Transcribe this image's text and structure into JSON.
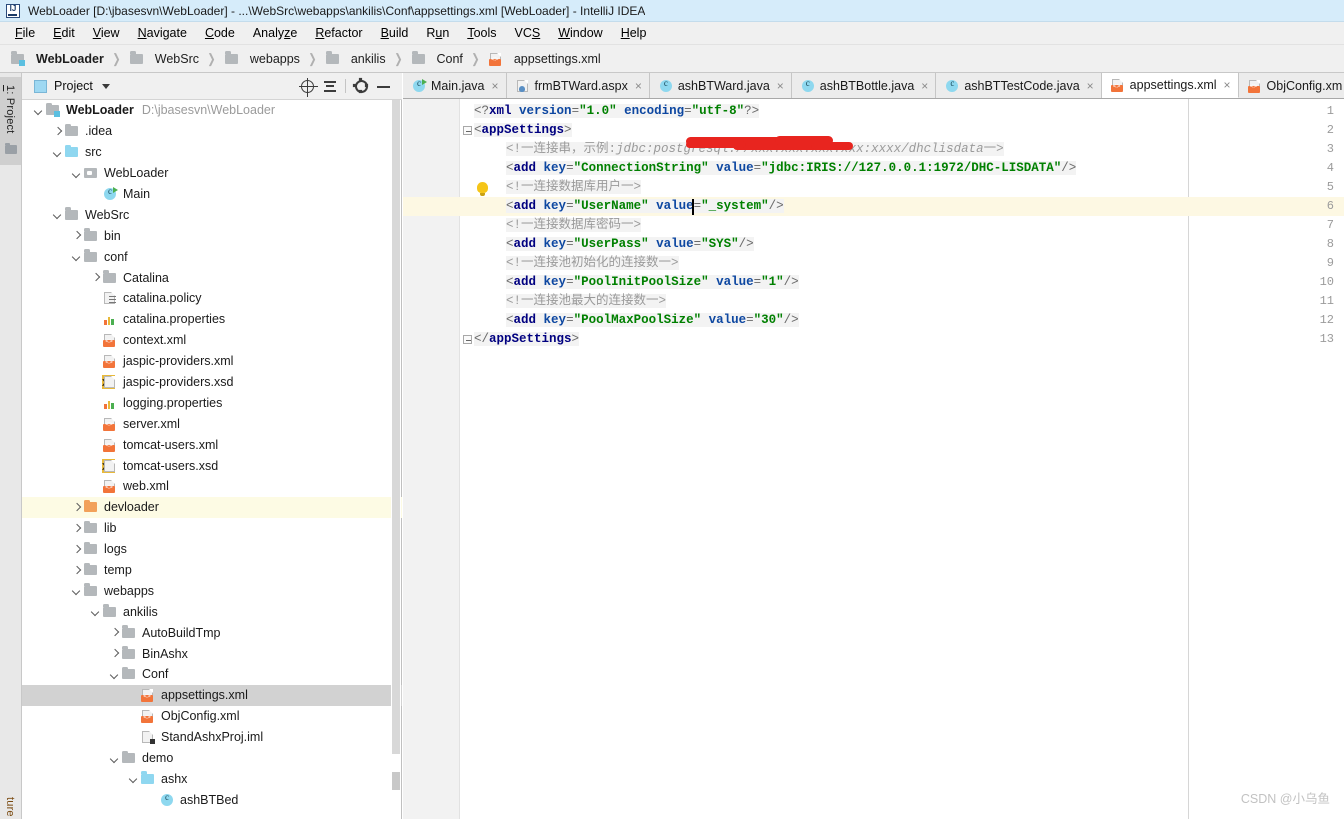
{
  "window": {
    "title": "WebLoader [D:\\jbasesvn\\WebLoader] - ...\\WebSrc\\webapps\\ankilis\\Conf\\appsettings.xml [WebLoader] - IntelliJ IDEA",
    "app_icon": "intellij-idea-logo"
  },
  "menubar": [
    {
      "label": "File",
      "mnemonic": "F"
    },
    {
      "label": "Edit",
      "mnemonic": "E"
    },
    {
      "label": "View",
      "mnemonic": "V"
    },
    {
      "label": "Navigate",
      "mnemonic": "N"
    },
    {
      "label": "Code",
      "mnemonic": "C"
    },
    {
      "label": "Analyze",
      "mnemonic": "z"
    },
    {
      "label": "Refactor",
      "mnemonic": "R"
    },
    {
      "label": "Build",
      "mnemonic": "B"
    },
    {
      "label": "Run",
      "mnemonic": "u"
    },
    {
      "label": "Tools",
      "mnemonic": "T"
    },
    {
      "label": "VCS",
      "mnemonic": "S"
    },
    {
      "label": "Window",
      "mnemonic": "W"
    },
    {
      "label": "Help",
      "mnemonic": "H"
    }
  ],
  "breadcrumb": [
    {
      "label": "WebLoader",
      "icon": "module-icon"
    },
    {
      "label": "WebSrc",
      "icon": "folder-icon"
    },
    {
      "label": "webapps",
      "icon": "folder-icon"
    },
    {
      "label": "ankilis",
      "icon": "folder-icon"
    },
    {
      "label": "Conf",
      "icon": "folder-icon"
    },
    {
      "label": "appsettings.xml",
      "icon": "xml-file-icon"
    }
  ],
  "toolstrip": {
    "top_label": "1: Project",
    "top_mnemonic": "1",
    "bottom_label": "ture",
    "folder_icon": "folder-icon"
  },
  "project_panel": {
    "title": "Project",
    "actions": [
      {
        "name": "select-opened-file-button",
        "icon": "target-icon"
      },
      {
        "name": "collapse-all-button",
        "icon": "collapse-all-icon"
      },
      {
        "name": "settings-button",
        "icon": "gear-icon"
      },
      {
        "name": "hide-button",
        "icon": "minus-icon"
      }
    ],
    "tree": [
      {
        "label": "WebLoader",
        "sub": "D:\\jbasesvn\\WebLoader",
        "depth": 0,
        "twist": "d",
        "icon": "module-icon",
        "bold": true
      },
      {
        "label": ".idea",
        "depth": 1,
        "twist": "r",
        "icon": "folder-icon"
      },
      {
        "label": "src",
        "depth": 1,
        "twist": "d",
        "icon": "source-folder-icon"
      },
      {
        "label": "WebLoader",
        "depth": 2,
        "twist": "d",
        "icon": "package-icon"
      },
      {
        "label": "Main",
        "depth": 3,
        "twist": "",
        "icon": "java-class-runnable-icon"
      },
      {
        "label": "WebSrc",
        "depth": 1,
        "twist": "d",
        "icon": "folder-icon"
      },
      {
        "label": "bin",
        "depth": 2,
        "twist": "r",
        "icon": "folder-icon"
      },
      {
        "label": "conf",
        "depth": 2,
        "twist": "d",
        "icon": "folder-icon"
      },
      {
        "label": "Catalina",
        "depth": 3,
        "twist": "r",
        "icon": "folder-icon"
      },
      {
        "label": "catalina.policy",
        "depth": 3,
        "twist": "",
        "icon": "policy-file-icon"
      },
      {
        "label": "catalina.properties",
        "depth": 3,
        "twist": "",
        "icon": "properties-file-icon"
      },
      {
        "label": "context.xml",
        "depth": 3,
        "twist": "",
        "icon": "xml-file-icon"
      },
      {
        "label": "jaspic-providers.xml",
        "depth": 3,
        "twist": "",
        "icon": "xml-file-icon"
      },
      {
        "label": "jaspic-providers.xsd",
        "depth": 3,
        "twist": "",
        "icon": "xsd-file-icon"
      },
      {
        "label": "logging.properties",
        "depth": 3,
        "twist": "",
        "icon": "properties-file-icon"
      },
      {
        "label": "server.xml",
        "depth": 3,
        "twist": "",
        "icon": "xml-file-icon"
      },
      {
        "label": "tomcat-users.xml",
        "depth": 3,
        "twist": "",
        "icon": "xml-file-icon"
      },
      {
        "label": "tomcat-users.xsd",
        "depth": 3,
        "twist": "",
        "icon": "xsd-file-icon"
      },
      {
        "label": "web.xml",
        "depth": 3,
        "twist": "",
        "icon": "xml-file-icon"
      },
      {
        "label": "devloader",
        "depth": 2,
        "twist": "r",
        "icon": "folder-orange-icon",
        "state": "highlight"
      },
      {
        "label": "lib",
        "depth": 2,
        "twist": "r",
        "icon": "folder-icon"
      },
      {
        "label": "logs",
        "depth": 2,
        "twist": "r",
        "icon": "folder-icon"
      },
      {
        "label": "temp",
        "depth": 2,
        "twist": "r",
        "icon": "folder-icon"
      },
      {
        "label": "webapps",
        "depth": 2,
        "twist": "d",
        "icon": "folder-icon"
      },
      {
        "label": "ankilis",
        "depth": 3,
        "twist": "d",
        "icon": "folder-icon"
      },
      {
        "label": "AutoBuildTmp",
        "depth": 4,
        "twist": "r",
        "icon": "folder-icon"
      },
      {
        "label": "BinAshx",
        "depth": 4,
        "twist": "r",
        "icon": "folder-icon"
      },
      {
        "label": "Conf",
        "depth": 4,
        "twist": "d",
        "icon": "folder-icon"
      },
      {
        "label": "appsettings.xml",
        "depth": 5,
        "twist": "",
        "icon": "xml-file-icon",
        "state": "selected"
      },
      {
        "label": "ObjConfig.xml",
        "depth": 5,
        "twist": "",
        "icon": "xml-file-icon"
      },
      {
        "label": "StandAshxProj.iml",
        "depth": 5,
        "twist": "",
        "icon": "iml-file-icon"
      },
      {
        "label": "demo",
        "depth": 4,
        "twist": "d",
        "icon": "folder-icon"
      },
      {
        "label": "ashx",
        "depth": 5,
        "twist": "d",
        "icon": "source-folder-icon"
      },
      {
        "label": "ashBTBed",
        "depth": 6,
        "twist": "",
        "icon": "java-class-icon"
      }
    ]
  },
  "editor": {
    "tabs": [
      {
        "label": "Main.java",
        "icon": "java-class-runnable-icon",
        "active": false
      },
      {
        "label": "frmBTWard.aspx",
        "icon": "aspx-file-icon",
        "active": false
      },
      {
        "label": "ashBTWard.java",
        "icon": "java-class-icon",
        "active": false
      },
      {
        "label": "ashBTBottle.java",
        "icon": "java-class-icon",
        "active": false
      },
      {
        "label": "ashBTTestCode.java",
        "icon": "java-class-icon",
        "active": false
      },
      {
        "label": "appsettings.xml",
        "icon": "xml-file-icon",
        "active": true
      },
      {
        "label": "ObjConfig.xm",
        "icon": "xml-file-icon",
        "active": false
      }
    ],
    "close_glyph": "×",
    "line_numbers": [
      "1",
      "2",
      "3",
      "4",
      "5",
      "6",
      "7",
      "8",
      "9",
      "10",
      "11",
      "12",
      "13"
    ],
    "caret_line": 6,
    "code_lines": [
      {
        "n": 1,
        "indent": 0,
        "parts": [
          {
            "t": "<?",
            "c": "tk-br"
          },
          {
            "t": "xml",
            "c": "tk-tag"
          },
          {
            "t": " ",
            "c": "tk-br"
          },
          {
            "t": "version",
            "c": "tk-attr"
          },
          {
            "t": "=",
            "c": "tk-br"
          },
          {
            "t": "\"1.0\"",
            "c": "tk-val"
          },
          {
            "t": " ",
            "c": "tk-br"
          },
          {
            "t": "encoding",
            "c": "tk-attr"
          },
          {
            "t": "=",
            "c": "tk-br"
          },
          {
            "t": "\"utf-8\"",
            "c": "tk-val"
          },
          {
            "t": "?>",
            "c": "tk-br"
          }
        ]
      },
      {
        "n": 2,
        "indent": 0,
        "parts": [
          {
            "t": "<",
            "c": "tk-br"
          },
          {
            "t": "appSettings",
            "c": "tk-tag"
          },
          {
            "t": ">",
            "c": "tk-br"
          }
        ]
      },
      {
        "n": 3,
        "indent": 2,
        "parts": [
          {
            "t": "<!一连接串，示例:",
            "c": "tk-cmt"
          },
          {
            "t": "jdbc:postgresql://",
            "c": "tk-cmt-i"
          },
          {
            "t": "xxx.xxx.xxx.xxx:xxxx",
            "c": "tk-cmt-i"
          },
          {
            "t": "/dhclisdata",
            "c": "tk-cmt-i"
          },
          {
            "t": "一>",
            "c": "tk-cmt"
          }
        ]
      },
      {
        "n": 4,
        "indent": 2,
        "parts": [
          {
            "t": "<",
            "c": "tk-br"
          },
          {
            "t": "add",
            "c": "tk-tag"
          },
          {
            "t": " ",
            "c": "tk-br"
          },
          {
            "t": "key",
            "c": "tk-attr"
          },
          {
            "t": "=",
            "c": "tk-br"
          },
          {
            "t": "\"ConnectionString\"",
            "c": "tk-val"
          },
          {
            "t": " ",
            "c": "tk-br"
          },
          {
            "t": "value",
            "c": "tk-attr"
          },
          {
            "t": "=",
            "c": "tk-br"
          },
          {
            "t": "\"jdbc:IRIS://127.0.0.1:1972/DHC-LISDATA\"",
            "c": "tk-val"
          },
          {
            "t": "/>",
            "c": "tk-br"
          }
        ]
      },
      {
        "n": 5,
        "indent": 2,
        "parts": [
          {
            "t": "<!一连接数据库用户一>",
            "c": "tk-cmt"
          }
        ]
      },
      {
        "n": 6,
        "indent": 2,
        "parts": [
          {
            "t": "<",
            "c": "tk-br"
          },
          {
            "t": "add",
            "c": "tk-tag"
          },
          {
            "t": " ",
            "c": "tk-br"
          },
          {
            "t": "key",
            "c": "tk-attr"
          },
          {
            "t": "=",
            "c": "tk-br"
          },
          {
            "t": "\"UserName\"",
            "c": "tk-val"
          },
          {
            "t": " ",
            "c": "tk-br"
          },
          {
            "t": "value",
            "c": "tk-attr"
          },
          {
            "t": "=",
            "c": "tk-br"
          },
          {
            "t": "\"_system\"",
            "c": "tk-val"
          },
          {
            "t": "/>",
            "c": "tk-br"
          }
        ]
      },
      {
        "n": 7,
        "indent": 2,
        "parts": [
          {
            "t": "<!一连接数据库密码一>",
            "c": "tk-cmt"
          }
        ]
      },
      {
        "n": 8,
        "indent": 2,
        "parts": [
          {
            "t": "<",
            "c": "tk-br"
          },
          {
            "t": "add",
            "c": "tk-tag"
          },
          {
            "t": " ",
            "c": "tk-br"
          },
          {
            "t": "key",
            "c": "tk-attr"
          },
          {
            "t": "=",
            "c": "tk-br"
          },
          {
            "t": "\"UserPass\"",
            "c": "tk-val"
          },
          {
            "t": " ",
            "c": "tk-br"
          },
          {
            "t": "value",
            "c": "tk-attr"
          },
          {
            "t": "=",
            "c": "tk-br"
          },
          {
            "t": "\"SYS\"",
            "c": "tk-val"
          },
          {
            "t": "/>",
            "c": "tk-br"
          }
        ]
      },
      {
        "n": 9,
        "indent": 2,
        "parts": [
          {
            "t": "<!一连接池初始化的连接数一>",
            "c": "tk-cmt"
          }
        ]
      },
      {
        "n": 10,
        "indent": 2,
        "parts": [
          {
            "t": "<",
            "c": "tk-br"
          },
          {
            "t": "add",
            "c": "tk-tag"
          },
          {
            "t": " ",
            "c": "tk-br"
          },
          {
            "t": "key",
            "c": "tk-attr"
          },
          {
            "t": "=",
            "c": "tk-br"
          },
          {
            "t": "\"PoolInitPoolSize\"",
            "c": "tk-val"
          },
          {
            "t": " ",
            "c": "tk-br"
          },
          {
            "t": "value",
            "c": "tk-attr"
          },
          {
            "t": "=",
            "c": "tk-br"
          },
          {
            "t": "\"1\"",
            "c": "tk-val"
          },
          {
            "t": "/>",
            "c": "tk-br"
          }
        ]
      },
      {
        "n": 11,
        "indent": 2,
        "parts": [
          {
            "t": "<!一连接池最大的连接数一>",
            "c": "tk-cmt"
          }
        ]
      },
      {
        "n": 12,
        "indent": 2,
        "parts": [
          {
            "t": "<",
            "c": "tk-br"
          },
          {
            "t": "add",
            "c": "tk-tag"
          },
          {
            "t": " ",
            "c": "tk-br"
          },
          {
            "t": "key",
            "c": "tk-attr"
          },
          {
            "t": "=",
            "c": "tk-br"
          },
          {
            "t": "\"PoolMaxPoolSize\"",
            "c": "tk-val"
          },
          {
            "t": " ",
            "c": "tk-br"
          },
          {
            "t": "value",
            "c": "tk-attr"
          },
          {
            "t": "=",
            "c": "tk-br"
          },
          {
            "t": "\"30\"",
            "c": "tk-val"
          },
          {
            "t": "/>",
            "c": "tk-br"
          }
        ]
      },
      {
        "n": 13,
        "indent": 0,
        "parts": [
          {
            "t": "</",
            "c": "tk-br"
          },
          {
            "t": "appSettings",
            "c": "tk-tag"
          },
          {
            "t": ">",
            "c": "tk-br"
          }
        ]
      }
    ],
    "fold_lines": [
      2,
      13
    ],
    "bulb_line": 5,
    "redaction_color": "#e8251f"
  },
  "watermark": "CSDN @小乌鱼",
  "colors": {
    "titlebar_bg": "#d6ecfa",
    "menubar_bg": "#f0f0f0",
    "panel_bg": "#ffffff",
    "selection_bg": "#d2d2d2",
    "highlight_bg": "#fdfbe4",
    "caret_line_bg": "#fdf8e3",
    "xml_tag": "#000080",
    "xml_attr": "#0d47a1",
    "xml_value": "#008000",
    "comment": "#9a9a9a"
  }
}
